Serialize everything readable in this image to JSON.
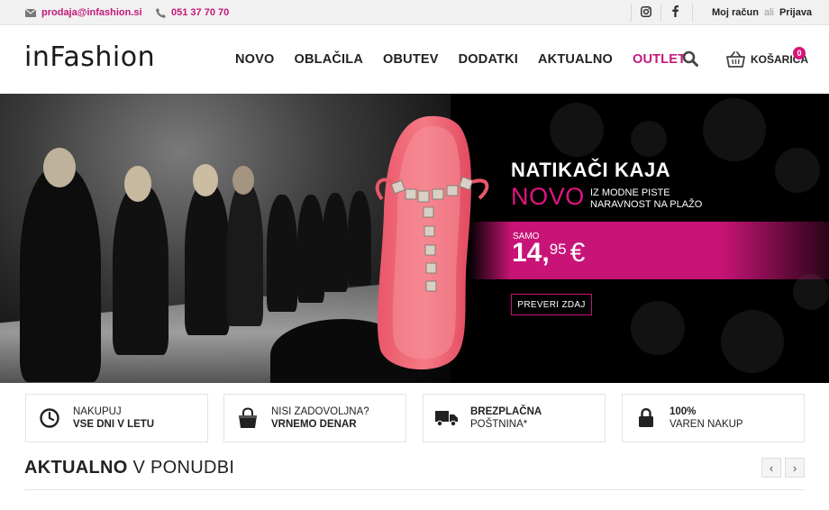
{
  "topbar": {
    "email": "prodaja@infashion.si",
    "phone": "051 37 70 70",
    "account": "Moj račun",
    "or": "ali",
    "login": "Prijava"
  },
  "header": {
    "logo": "inFashion",
    "nav": [
      "NOVO",
      "OBLAČILA",
      "OBUTEV",
      "DODATKI",
      "AKTUALNO",
      "OUTLET"
    ],
    "cart_label": "KOŠARICA",
    "cart_count": "0"
  },
  "hero": {
    "title": "NATIKAČI KAJA",
    "novo": "NOVO",
    "subtitle_line1": "IZ MODNE PISTE",
    "subtitle_line2": "NARAVNOST NA PLAŽO",
    "samo": "SAMO",
    "price_whole": "14,",
    "price_decimal": "95",
    "currency": "€",
    "cta": "PREVERI ZDAJ"
  },
  "features": [
    {
      "line1": "NAKUPUJ",
      "line2": "VSE DNI V LETU",
      "icon": "clock-icon"
    },
    {
      "line1": "NISI ZADOVOLJNA?",
      "line2": "VRNEMO DENAR",
      "icon": "bag-icon"
    },
    {
      "line1": "BREZPLAČNA",
      "line2": "POŠTNINA*",
      "icon": "truck-icon"
    },
    {
      "line1": "100%",
      "line2": "VAREN NAKUP",
      "icon": "lock-icon"
    }
  ],
  "section": {
    "title_bold": "AKTUALNO",
    "title_rest": "V PONUDBI"
  },
  "colors": {
    "accent": "#c81476",
    "dark": "#222222"
  }
}
